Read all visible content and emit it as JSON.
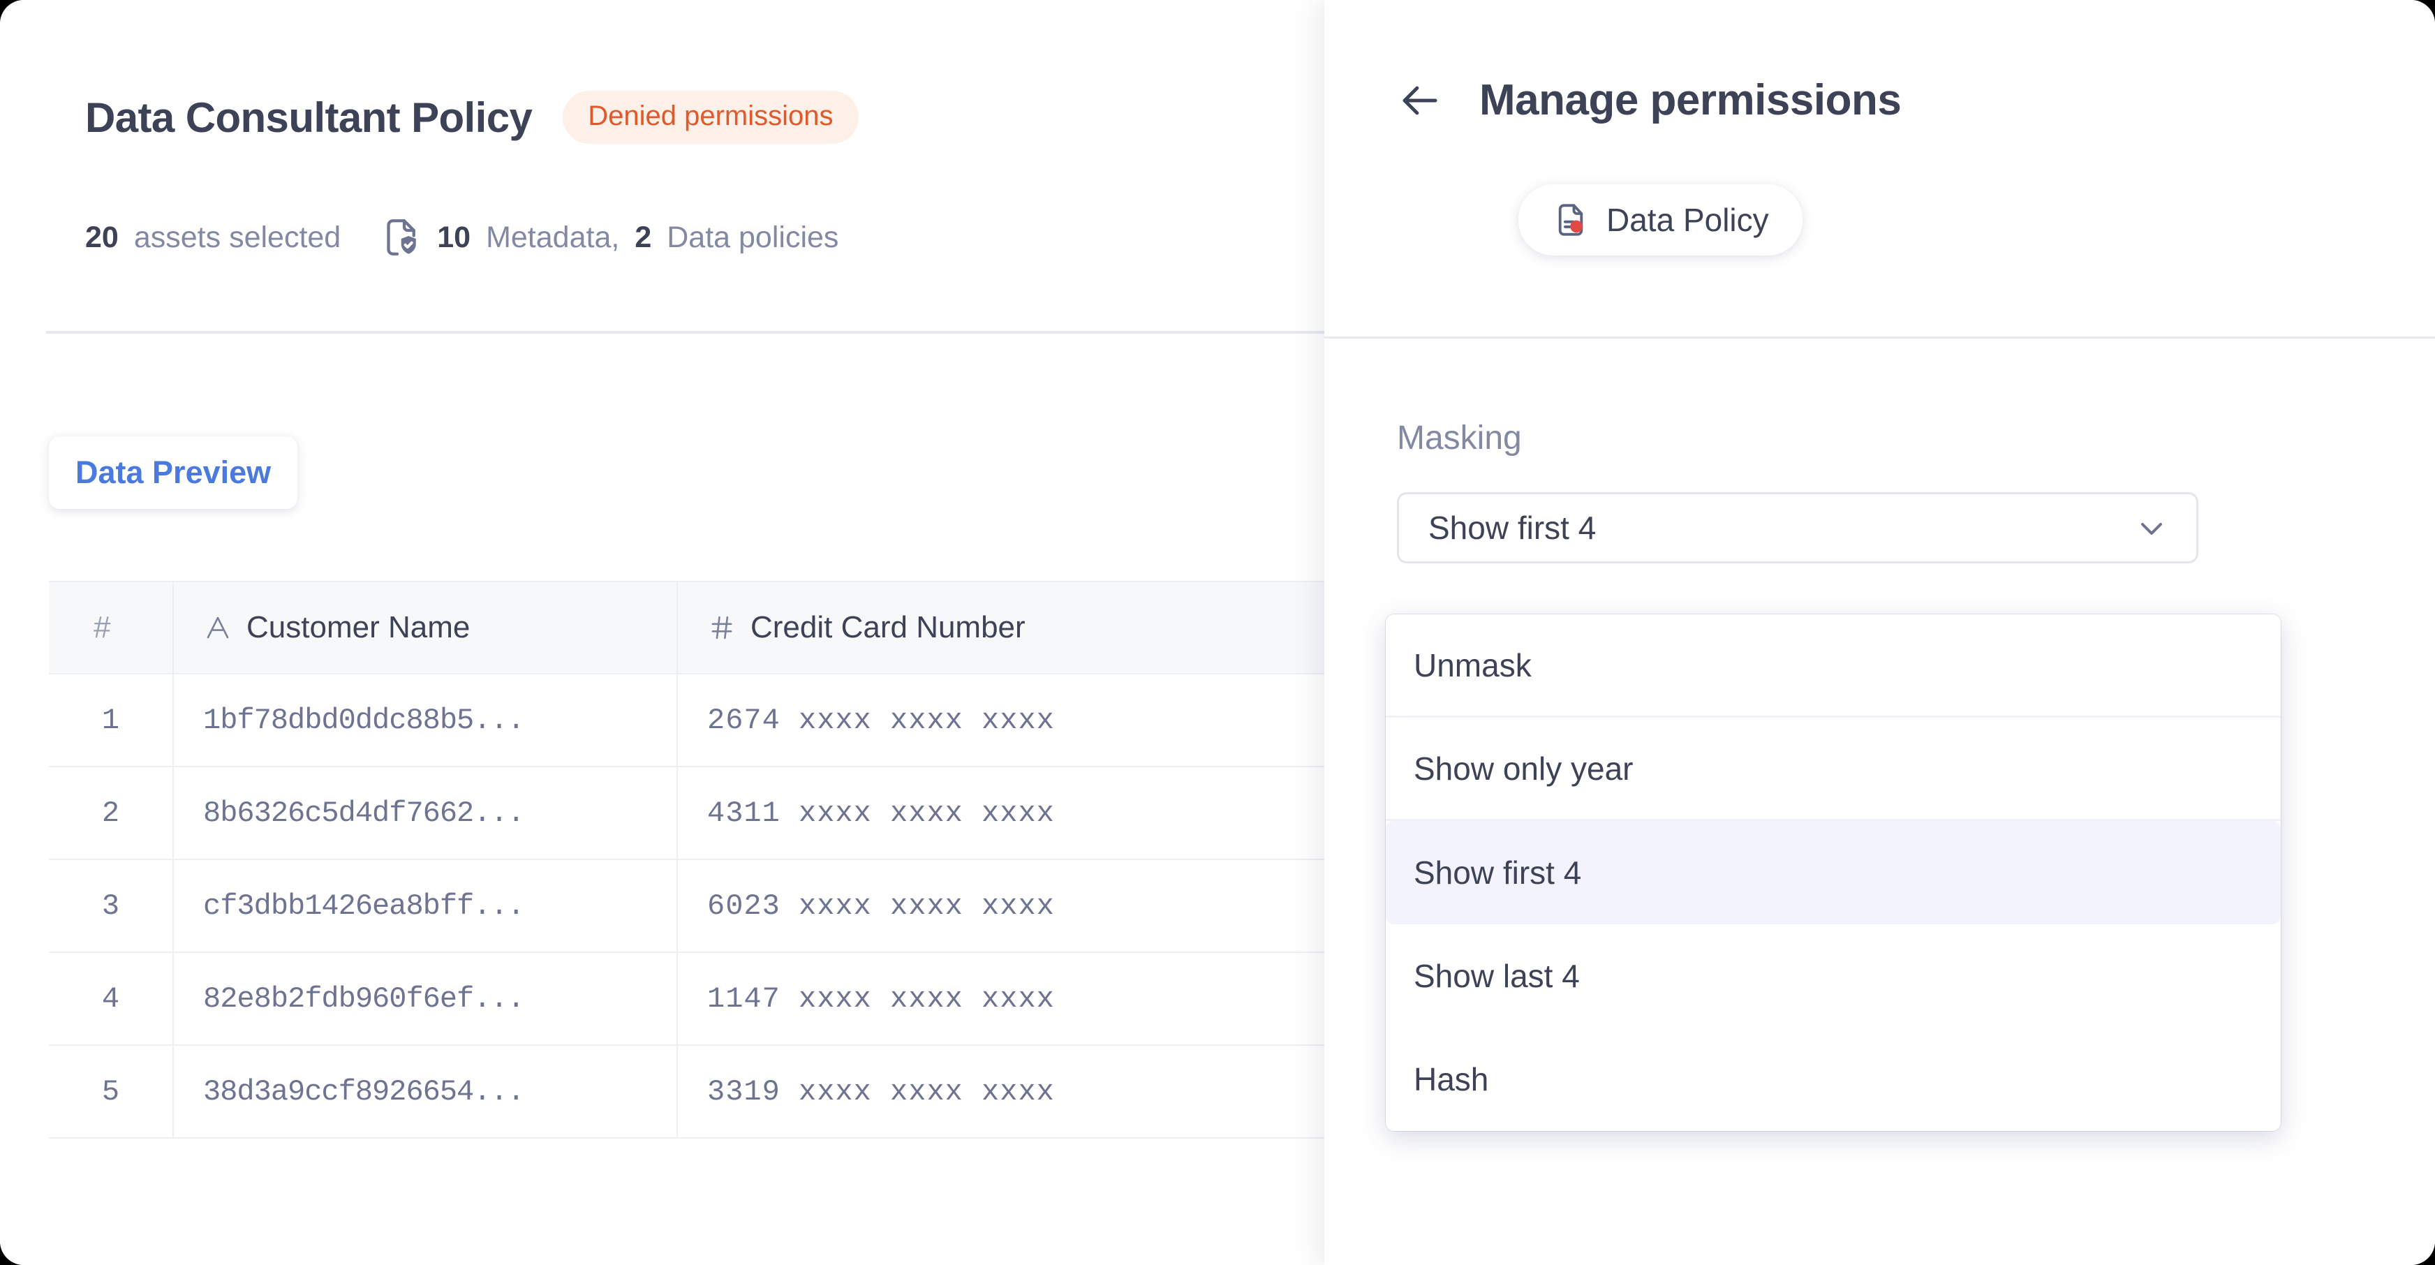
{
  "left": {
    "page_title": "Data Consultant Policy",
    "status_badge": "Denied permissions",
    "meta": {
      "assets_count": "20",
      "assets_label": "assets selected",
      "policies_icon": "document-shield-check-icon",
      "policies_text_part1": "10",
      "policies_text_part2": "Metadata,",
      "policies_text_part3": "2",
      "policies_text_part4": "Data policies"
    },
    "tabs": [
      {
        "label": "Data Preview",
        "active": true
      }
    ],
    "table": {
      "columns": [
        {
          "key": "num",
          "label": "#",
          "icon": "hash-icon"
        },
        {
          "key": "name",
          "label": "Customer Name",
          "icon": "text-type-icon"
        },
        {
          "key": "card",
          "label": "Credit Card Number",
          "icon": "number-type-icon"
        }
      ],
      "rows": [
        {
          "num": "1",
          "name": "1bf78dbd0ddc88b5...",
          "card": "2674 xxxx xxxx xxxx"
        },
        {
          "num": "2",
          "name": "8b6326c5d4df7662...",
          "card": "4311 xxxx xxxx xxxx"
        },
        {
          "num": "3",
          "name": "cf3dbb1426ea8bff...",
          "card": "6023 xxxx xxxx xxxx"
        },
        {
          "num": "4",
          "name": "82e8b2fdb960f6ef...",
          "card": "1147 xxxx xxxx xxxx"
        },
        {
          "num": "5",
          "name": "38d3a9ccf8926654...",
          "card": "3319 xxxx xxxx xxxx"
        }
      ]
    }
  },
  "right": {
    "back_icon": "arrow-left-icon",
    "title": "Manage permissions",
    "chip": {
      "icon": "data-policy-document-icon",
      "label": "Data Policy"
    },
    "masking": {
      "label": "Masking",
      "selected": "Show first 4",
      "chevron_icon": "chevron-down-icon",
      "options": [
        {
          "label": "Unmask",
          "selected": false
        },
        {
          "label": "Show only year",
          "selected": false
        },
        {
          "label": "Show first 4",
          "selected": true
        },
        {
          "label": "Show last 4",
          "selected": false
        },
        {
          "label": "Hash",
          "selected": false
        }
      ]
    }
  },
  "colors": {
    "heading": "#3d4257",
    "muted": "#8389a3",
    "badge_bg": "#fdf0e9",
    "badge_text": "#e1592a",
    "tab_active": "#4a7ade",
    "option_selected_bg": "#f2f3fc",
    "accent_red_dot": "#e04a43"
  }
}
